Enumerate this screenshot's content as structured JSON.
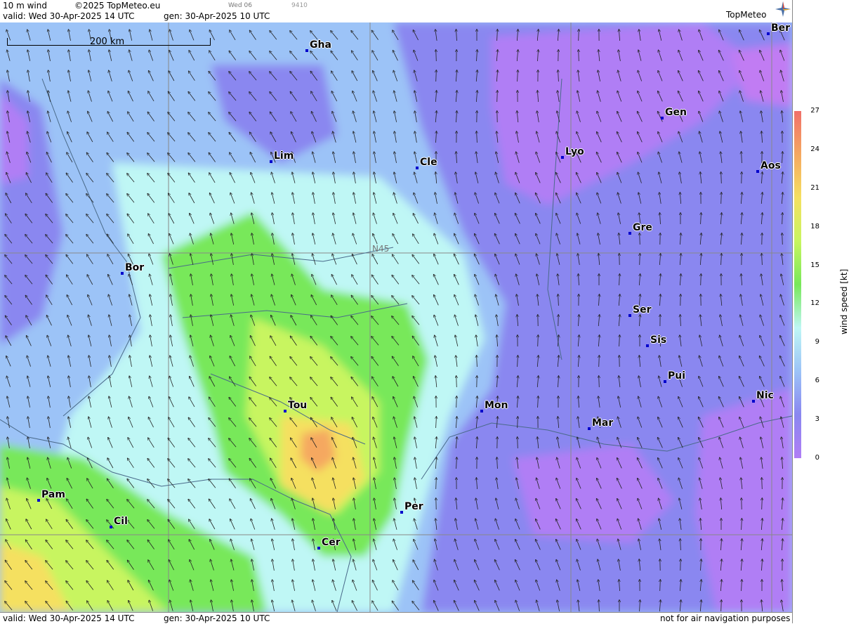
{
  "header": {
    "product": "10 m wind",
    "copyright": "©2025 TopMeteo.eu",
    "day_tab": "Wed 06",
    "code": "9410",
    "valid": "valid:  Wed  30-Apr-2025  14 UTC",
    "gen": "gen: 30-Apr-2025 10 UTC"
  },
  "footer": {
    "valid": "valid:  Wed  30-Apr-2025  14 UTC",
    "gen": "gen: 30-Apr-2025 10 UTC",
    "note": "not for air navigation purposes"
  },
  "logo": "TopMeteo",
  "scale_label": "200 km",
  "lat_label": "N45",
  "legend": {
    "unit": "wind  speed  [kt]",
    "ticks": [
      "27",
      "24",
      "21",
      "18",
      "15",
      "12",
      "9",
      "6",
      "3",
      "0"
    ],
    "colors": [
      "#f0706a",
      "#f5a860",
      "#f5e060",
      "#c8f560",
      "#78e85a",
      "#bff7f5",
      "#9cc3f7",
      "#8a87f0",
      "#b07ef5"
    ]
  },
  "cities": [
    {
      "name": "Ber"
    },
    {
      "name": "Gha"
    },
    {
      "name": "Gen"
    },
    {
      "name": "Lim"
    },
    {
      "name": "Cle"
    },
    {
      "name": "Lyo"
    },
    {
      "name": "Aos"
    },
    {
      "name": "Gre"
    },
    {
      "name": "Bor"
    },
    {
      "name": "Ser"
    },
    {
      "name": "Sis"
    },
    {
      "name": "Pui"
    },
    {
      "name": "Nic"
    },
    {
      "name": "Tou"
    },
    {
      "name": "Mon"
    },
    {
      "name": "Mar"
    },
    {
      "name": "Pam"
    },
    {
      "name": "Cil"
    },
    {
      "name": "Per"
    },
    {
      "name": "Cer"
    }
  ]
}
